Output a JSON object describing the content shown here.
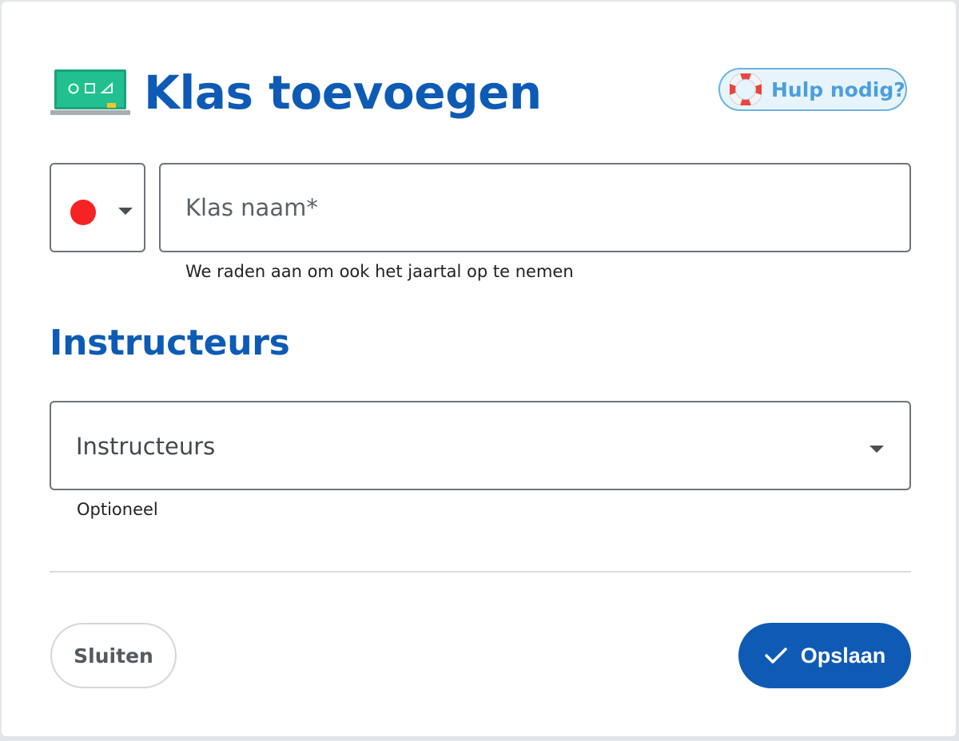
{
  "dialog": {
    "title": "Klas toevoegen",
    "title_icon": "chalkboard-icon",
    "help_button": {
      "label": "Hulp nodig?",
      "icon": "lifebuoy-icon"
    }
  },
  "class_form": {
    "color_picker": {
      "selected_color": "#f52323",
      "icon": "chevron-down-icon"
    },
    "class_name": {
      "placeholder": "Klas naam*",
      "value": ""
    },
    "class_name_hint": "We raden aan om ook het jaartal op te nemen"
  },
  "instructors": {
    "section_title": "Instructeurs",
    "select_placeholder": "Instructeurs",
    "hint": "Optioneel"
  },
  "footer": {
    "close_label": "Sluiten",
    "save_label": "Opslaan",
    "save_icon": "check-icon"
  },
  "colors": {
    "primary": "#0d5bb5",
    "help_accent": "#4c9fdc",
    "save_button": "#0f5ab5"
  }
}
